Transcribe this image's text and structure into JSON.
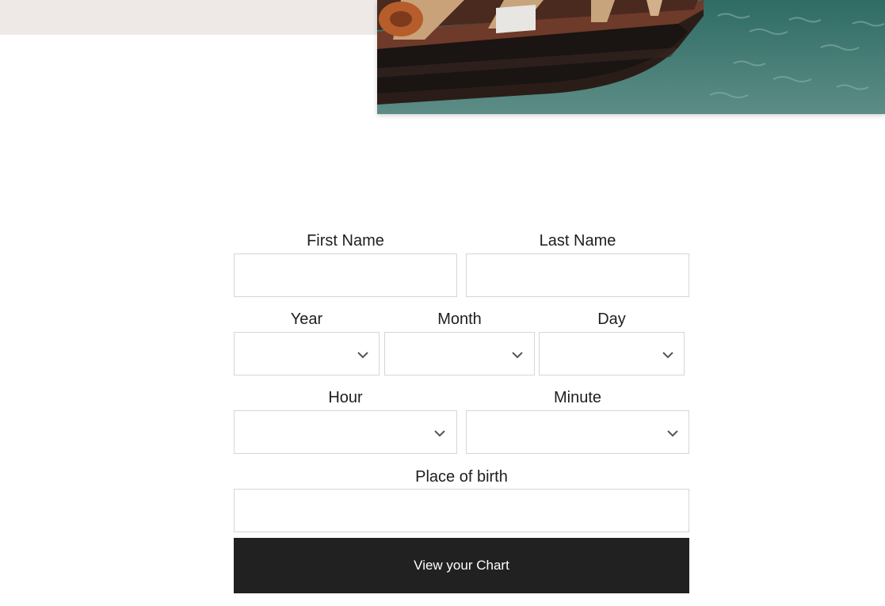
{
  "form": {
    "first_name": {
      "label": "First Name",
      "value": ""
    },
    "last_name": {
      "label": "Last Name",
      "value": ""
    },
    "year": {
      "label": "Year",
      "selected": ""
    },
    "month": {
      "label": "Month",
      "selected": ""
    },
    "day": {
      "label": "Day",
      "selected": ""
    },
    "hour": {
      "label": "Hour",
      "selected": ""
    },
    "minute": {
      "label": "Minute",
      "selected": ""
    },
    "place_of_birth": {
      "label": "Place of birth",
      "value": ""
    },
    "submit_label": "View your Chart"
  },
  "icons": {
    "select_arrow": "chevron-down-icon"
  },
  "colors": {
    "top_band": "#eee9e7",
    "field_border": "#d6d6d6",
    "button_bg": "#212121",
    "button_text": "#ffffff",
    "text": "#1e1e1e"
  }
}
